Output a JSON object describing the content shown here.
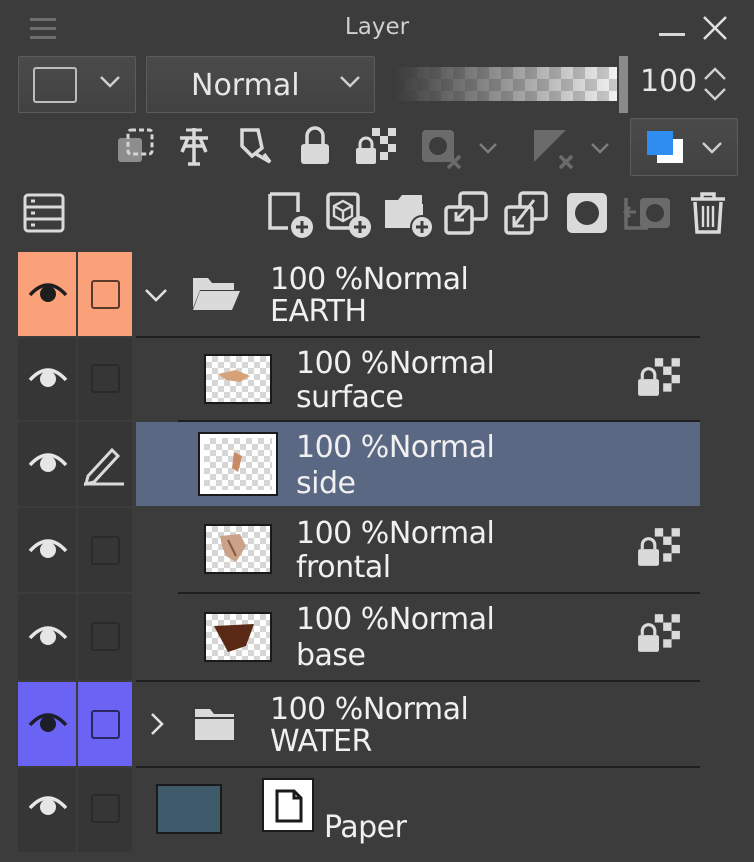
{
  "panel": {
    "title": "Layer"
  },
  "toolbar": {
    "blend_mode": "Normal",
    "opacity_value": "100"
  },
  "colors": {
    "background": "#3c3c3c",
    "selected_row": "#5b6884",
    "earth_folder_color": "#fba17a",
    "water_folder_color": "#6a63f4",
    "paper_color": "#3f5a6b",
    "accent_blue": "#2f8cf0"
  },
  "layers": [
    {
      "opacity": "100 %",
      "blend": "Normal",
      "name": "EARTH",
      "type": "folder",
      "expanded": true,
      "icon": "folder-open-icon"
    },
    {
      "opacity": "100 %",
      "blend": "Normal",
      "name": "surface",
      "type": "raster",
      "locked_transparency": true
    },
    {
      "opacity": "100 %",
      "blend": "Normal",
      "name": "side",
      "type": "raster",
      "selected": true,
      "editing": true
    },
    {
      "opacity": "100 %",
      "blend": "Normal",
      "name": "frontal",
      "type": "raster",
      "locked_transparency": true
    },
    {
      "opacity": "100 %",
      "blend": "Normal",
      "name": "base",
      "type": "raster",
      "locked_transparency": true
    },
    {
      "opacity": "100 %",
      "blend": "Normal",
      "name": "WATER",
      "type": "folder",
      "expanded": false,
      "icon": "folder-closed-icon"
    },
    {
      "name": "Paper",
      "type": "paper"
    }
  ]
}
